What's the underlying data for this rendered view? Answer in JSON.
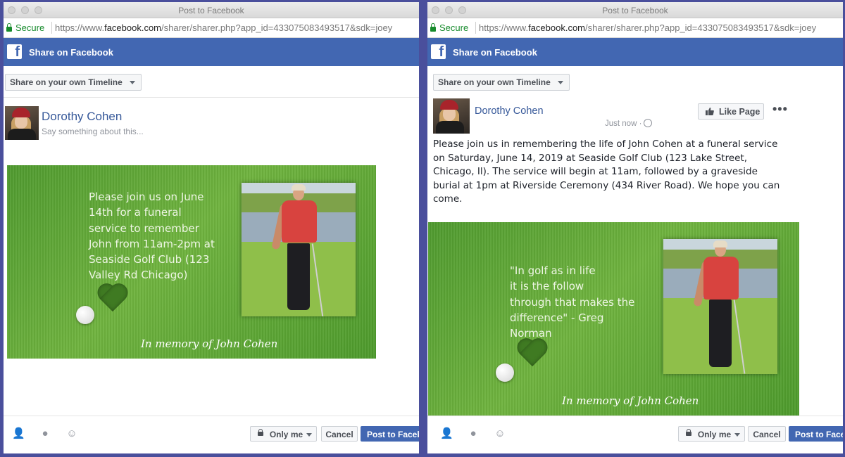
{
  "window": {
    "title": "Post to Facebook"
  },
  "address_bar": {
    "secure_label": "Secure",
    "url_prefix": "https://www.",
    "url_domain": "facebook.com",
    "url_path": "/sharer/sharer.php?app_id=433075083493517&sdk=joey"
  },
  "fb_header": {
    "title": "Share on Facebook",
    "logo": "f"
  },
  "share_target": "Share on your own Timeline",
  "user": {
    "name": "Dorothy Cohen"
  },
  "composer": {
    "placeholder": "Say something about this..."
  },
  "left_card": {
    "text": "Please join us on June\n14th for a funeral\nservice to remember\nJohn from 11am-2pm at\nSeaside Golf Club (123\nValley Rd Chicago)",
    "memory": "In memory of John Cohen"
  },
  "right_post": {
    "timestamp": "Just now ·",
    "like_page": "Like Page",
    "more": "•••",
    "body": "Please join us in remembering the life of John Cohen at a funeral service on Saturday, June 14, 2019 at Seaside Golf Club (123 Lake Street, Chicago, Il). The service will begin at 11am, followed by a graveside burial at 1pm at Riverside Ceremony (434 River Road). We hope you can come."
  },
  "right_card": {
    "quote": "\"In golf as in life\nit is the follow\nthrough that makes the\ndifference\" - Greg\nNorman",
    "memory": "In memory of John Cohen"
  },
  "footer": {
    "privacy": "Only me",
    "cancel": "Cancel",
    "post": "Post to Facebook"
  },
  "icons": [
    "tag-people-icon",
    "location-icon",
    "feeling-icon",
    "lock-icon",
    "globe-icon",
    "thumbs-up-icon"
  ]
}
